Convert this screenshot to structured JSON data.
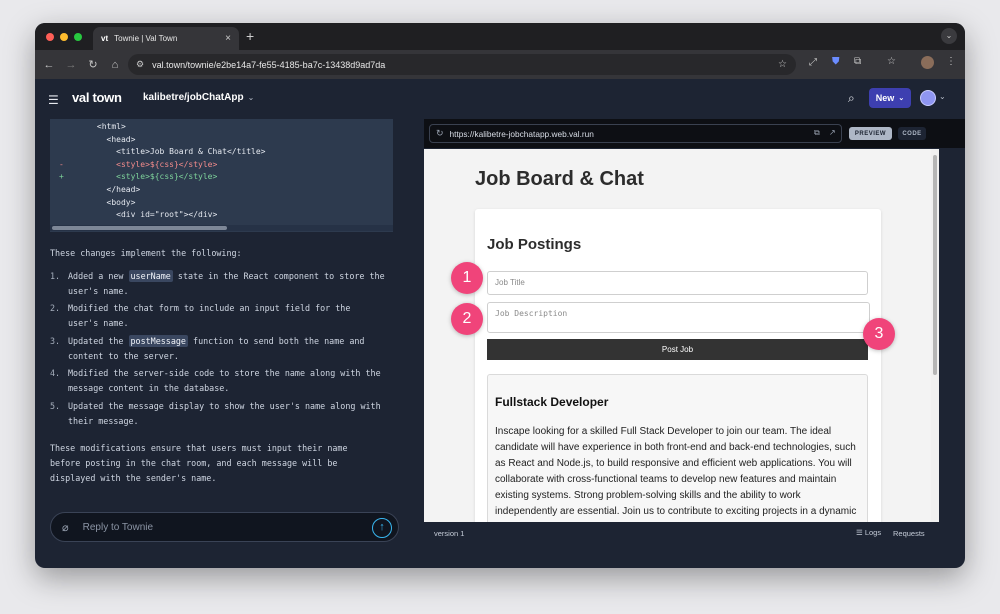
{
  "browser": {
    "tab_title": "Townie | Val Town",
    "tab_favicon": "vt",
    "url": "val.town/townie/e2be14a7-fe55-4185-ba7c-13438d9ad7da"
  },
  "app": {
    "logo": "val town",
    "project": "kalibetre/jobChatApp",
    "new_button": "New"
  },
  "code_snippet": {
    "lines": [
      {
        "marker": "",
        "text": "      <html>",
        "kind": "normal"
      },
      {
        "marker": "",
        "text": "        <head>",
        "kind": "normal"
      },
      {
        "marker": "",
        "text": "          <title>Job Board & Chat</title>",
        "kind": "normal"
      },
      {
        "marker": "-",
        "text": "          <style>${css}</style>",
        "kind": "del"
      },
      {
        "marker": "+",
        "text": "          <style>${css}</style>",
        "kind": "add"
      },
      {
        "marker": "",
        "text": "        </head>",
        "kind": "normal"
      },
      {
        "marker": "",
        "text": "        <body>",
        "kind": "normal"
      },
      {
        "marker": "",
        "text": "          <div id=\"root\"></div>",
        "kind": "normal"
      }
    ]
  },
  "chat": {
    "intro": "These changes implement the following:",
    "items": [
      {
        "num": "1.",
        "before": "Added a new ",
        "code": "userName",
        "after": " state in the React component to store the user's name."
      },
      {
        "num": "2.",
        "before": "Modified the chat form to include an input field for the user's name.",
        "code": "",
        "after": ""
      },
      {
        "num": "3.",
        "before": "Updated the ",
        "code": "postMessage",
        "after": " function to send both the name and content to the server."
      },
      {
        "num": "4.",
        "before": "Modified the server-side code to store the name along with the message content in the database.",
        "code": "",
        "after": ""
      },
      {
        "num": "5.",
        "before": "Updated the message display to show the user's name along with their message.",
        "code": "",
        "after": ""
      }
    ],
    "conclusion": "These modifications ensure that users must input their name before posting in the chat room, and each message will be displayed with the sender's name.",
    "reply_placeholder": "Reply to Townie"
  },
  "preview": {
    "url": "https://kalibetre-jobchatapp.web.val.run",
    "preview_label": "PREVIEW",
    "code_label": "CODE",
    "page_title": "Job Board & Chat",
    "section_title": "Job Postings",
    "job_title_placeholder": "Job Title",
    "job_desc_placeholder": "Job Description",
    "post_button": "Post Job",
    "job": {
      "title": "Fullstack Developer",
      "description": "Inscape looking for a skilled Full Stack Developer to join our team. The ideal candidate will have experience in both front-end and back-end technologies, such as React and Node.js, to build responsive and efficient web applications. You will collaborate with cross-functional teams to develop new features and maintain existing systems. Strong problem-solving skills and the ability to work independently are essential. Join us to contribute to exciting projects in a dynamic"
    },
    "version": "version 1",
    "logs": "Logs",
    "requests": "Requests"
  },
  "callouts": [
    "1",
    "2",
    "3"
  ],
  "colors": {
    "accent": "#3d3fb0",
    "callout": "#f0447a",
    "send": "#38b6ef"
  }
}
